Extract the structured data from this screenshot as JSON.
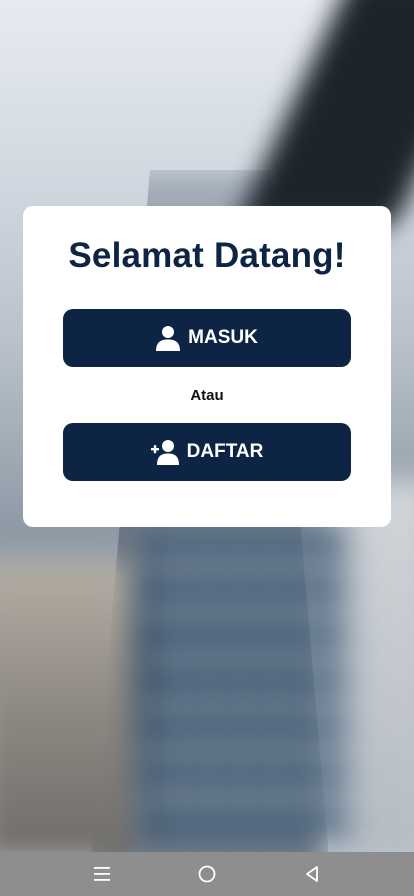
{
  "welcome": {
    "title": "Selamat Datang!"
  },
  "buttons": {
    "login_label": "MASUK",
    "register_label": "DAFTAR",
    "separator": "Atau"
  },
  "icons": {
    "login": "user-icon",
    "register": "user-plus-icon",
    "nav_menu": "menu-icon",
    "nav_home": "home-circle-icon",
    "nav_back": "back-triangle-icon"
  },
  "colors": {
    "primary": "#0d2445",
    "card": "#ffffff",
    "navbar": "#8e8e8e"
  }
}
